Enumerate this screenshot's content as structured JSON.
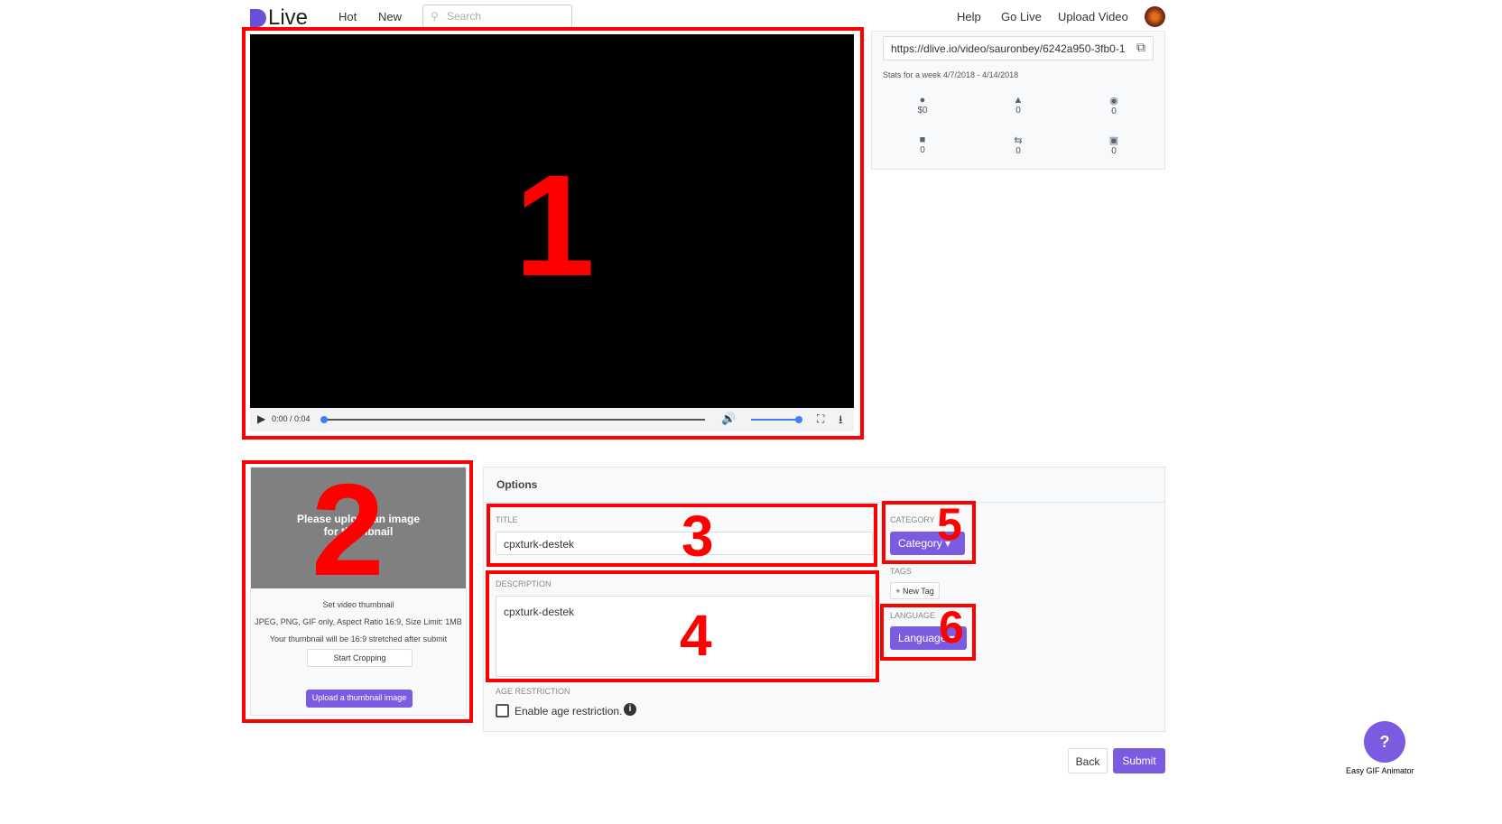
{
  "header": {
    "logo": "Live",
    "nav": [
      "Hot",
      "New"
    ],
    "search_placeholder": "Search",
    "right": [
      "Help",
      "Go Live",
      "Upload Video"
    ]
  },
  "player": {
    "time": "0:00 / 0:04",
    "progress": 0,
    "volume": 1.0
  },
  "share": {
    "url": "https://dlive.io/video/sauronbey/6242a950-3fb0-1",
    "stats_title": "Stats for a week 4/7/2018 - 4/14/2018",
    "stats": [
      {
        "icon": "dollar-icon",
        "value": "$0"
      },
      {
        "icon": "thumbs-up-icon",
        "value": "0"
      },
      {
        "icon": "eye-icon",
        "value": "0"
      },
      {
        "icon": "comment-icon",
        "value": "0"
      },
      {
        "icon": "repost-icon",
        "value": "0"
      },
      {
        "icon": "gift-icon",
        "value": "0"
      }
    ]
  },
  "thumbnail": {
    "placeholder": "Please upload an image for thumbnail",
    "set": "Set video thumbnail",
    "formats": "JPEG, PNG, GIF only, Aspect Ratio 16:9, Size Limit: 1MB",
    "note": "Your thumbnail will be 16:9 stretched after submit",
    "crop": "Start Cropping",
    "upload": "Upload a thumbnail image"
  },
  "options": {
    "title": "Options",
    "title_label": "TITLE",
    "title_value": "cpxturk-destek",
    "desc_label": "DESCRIPTION",
    "desc_value": "cpxturk-destek",
    "age_label": "AGE RESTRICTION",
    "age_check": "Enable age restriction.",
    "category_label": "CATEGORY",
    "category_btn": "Category",
    "tags_label": "TAGS",
    "new_tag": "+ New Tag",
    "language_label": "LANGUAGE",
    "language_btn": "Language"
  },
  "footer": {
    "back": "Back",
    "submit": "Submit",
    "help": "?",
    "watermark": "Easy GIF Animator"
  },
  "annotations": [
    "1",
    "2",
    "3",
    "4",
    "5",
    "6"
  ]
}
